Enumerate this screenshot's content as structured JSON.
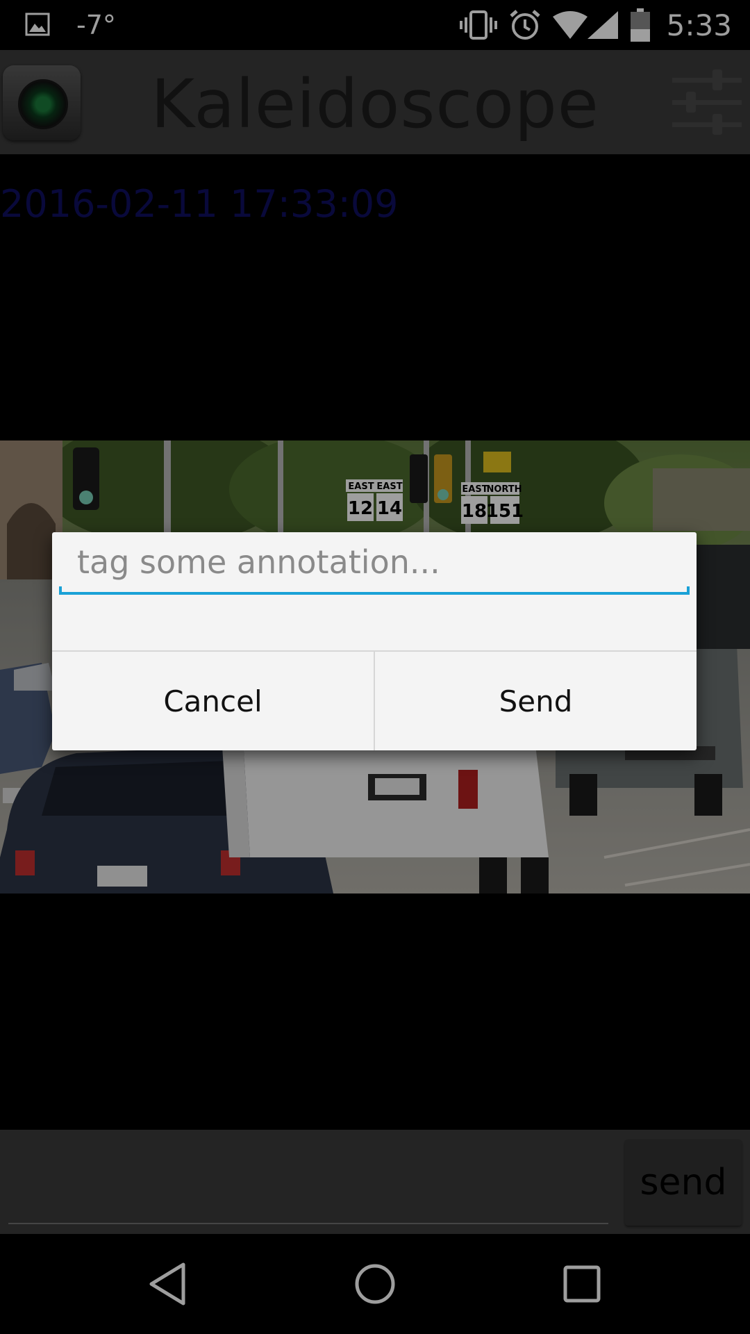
{
  "status_bar": {
    "temperature": "-7°",
    "time": "5:33",
    "icons": [
      "gallery-icon",
      "vibrate-icon",
      "alarm-icon",
      "wifi-icon",
      "signal-icon",
      "battery-icon"
    ]
  },
  "action_bar": {
    "title": "Kaleidoscope",
    "app_icon": "camera-lens-icon",
    "settings_icon": "sliders-icon"
  },
  "timestamp": "2016-02-11 17:33:09",
  "photo": {
    "signs": [
      "EAST",
      "EAST",
      "12",
      "14",
      "EAST",
      "NORTH",
      "18",
      "151"
    ]
  },
  "dialog": {
    "input_placeholder": "tag some annotation...",
    "input_value": "",
    "cancel_label": "Cancel",
    "send_label": "Send"
  },
  "bottom_bar": {
    "input_value": "",
    "send_label": "send"
  },
  "nav_bar": {
    "icons": [
      "back-icon",
      "home-icon",
      "recents-icon"
    ]
  },
  "colors": {
    "accent": "#1aa1d6",
    "timestamp": "#101060",
    "action_bar": "#3a3a3a"
  }
}
